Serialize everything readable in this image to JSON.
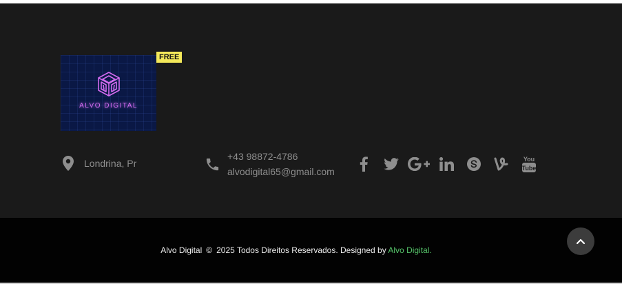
{
  "logo": {
    "text": "ALVO DIGITAL",
    "badge": "FREE",
    "colors": {
      "background": "#0a1845",
      "neon": "#d36bf0",
      "badge": "#f4e95a"
    }
  },
  "contact": {
    "location": "Londrina, Pr",
    "location_icon": "map-marker-icon",
    "phone": "+43 98872-4786",
    "email": "alvodigital65@gmail.com",
    "phone_icon": "phone-icon"
  },
  "social": [
    "facebook-icon",
    "twitter-icon",
    "google-plus-icon",
    "linkedin-icon",
    "skype-icon",
    "vine-icon",
    "youtube-icon"
  ],
  "footer": {
    "brand": "Alvo Digital",
    "copy_symbol": "©",
    "rights": "2025 Todos Direitos Reservados. Designed by",
    "designer_link": "Alvo Digital.",
    "link_color": "#56c46a",
    "scroll_top_icon": "chevron-up-icon"
  }
}
